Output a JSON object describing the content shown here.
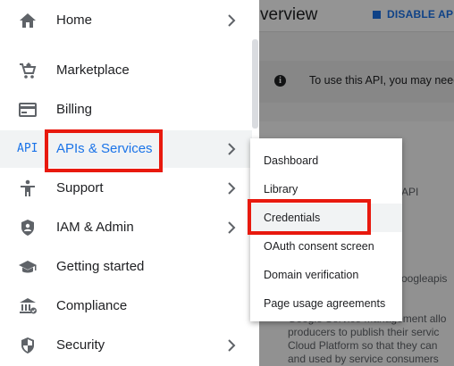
{
  "background": {
    "title": "verview",
    "disable_label": "DISABLE API",
    "notice_text": "To use this API, you may need",
    "api_fragment": "API",
    "googleapis_fragment": "oogleapis",
    "description_lines": [
      "Google Service Management allo",
      "producers to publish their servic",
      "Cloud Platform so that they can",
      "and used by service consumers"
    ]
  },
  "drawer": {
    "items": [
      {
        "label": "Home",
        "icon": "home-icon",
        "has_submenu": true
      },
      {
        "label": "Marketplace",
        "icon": "marketplace-cart-icon",
        "has_submenu": false
      },
      {
        "label": "Billing",
        "icon": "billing-card-icon",
        "has_submenu": false
      },
      {
        "label": "APIs & Services",
        "icon": "api-icon",
        "icon_text": "API",
        "has_submenu": true,
        "active": true
      },
      {
        "label": "Support",
        "icon": "support-person-icon",
        "has_submenu": true
      },
      {
        "label": "IAM & Admin",
        "icon": "shield-icon",
        "has_submenu": true
      },
      {
        "label": "Getting started",
        "icon": "graduation-cap-icon",
        "has_submenu": false
      },
      {
        "label": "Compliance",
        "icon": "bank-building-icon",
        "has_submenu": false
      },
      {
        "label": "Security",
        "icon": "security-shield-icon",
        "has_submenu": true
      }
    ]
  },
  "submenu": {
    "items": [
      {
        "label": "Dashboard"
      },
      {
        "label": "Library"
      },
      {
        "label": "Credentials",
        "hover": true
      },
      {
        "label": "OAuth consent screen"
      },
      {
        "label": "Domain verification"
      },
      {
        "label": "Page usage agreements"
      }
    ]
  },
  "colors": {
    "accent": "#1a73e8",
    "highlight": "#e8190e",
    "icon_gray": "#5f6368",
    "text": "#202124"
  }
}
